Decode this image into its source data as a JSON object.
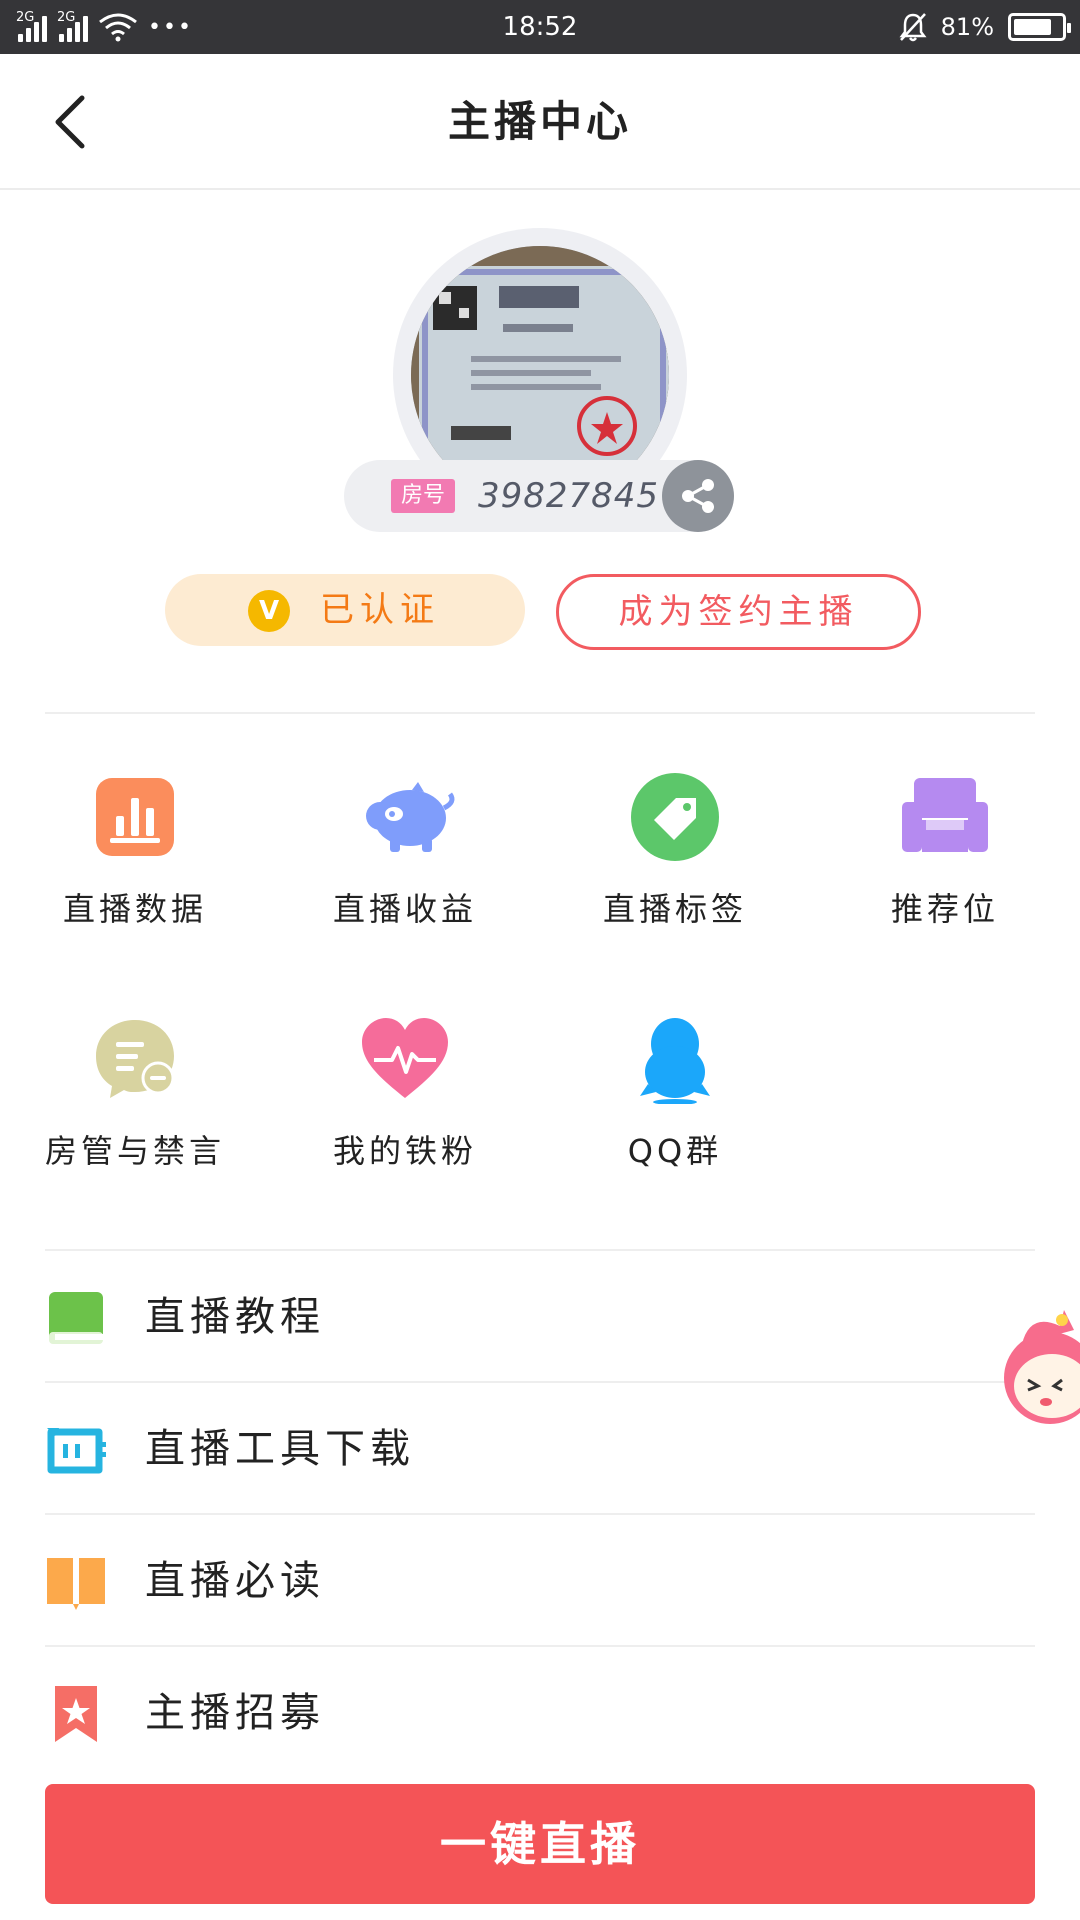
{
  "status_bar": {
    "network1": "2G",
    "network2": "2G",
    "more": "•••",
    "time": "18:52",
    "battery": "81%",
    "battery_level": 0.81
  },
  "header": {
    "title": "主播中心"
  },
  "profile": {
    "room_badge": "房号",
    "room_number": "39827845",
    "verified_label": "已认证",
    "verified_icon_letter": "V",
    "sign_label": "成为签约主播"
  },
  "grid": [
    {
      "label": "直播数据",
      "icon": "bar-chart-icon",
      "color": "#fb8d5c"
    },
    {
      "label": "直播收益",
      "icon": "piggy-bank-icon",
      "color": "#7f9dfb"
    },
    {
      "label": "直播标签",
      "icon": "tag-icon",
      "color": "#5cc76a"
    },
    {
      "label": "推荐位",
      "icon": "sofa-icon",
      "color": "#b58af0"
    },
    {
      "label": "房管与禁言",
      "icon": "chat-mute-icon",
      "color": "#d8d3a0"
    },
    {
      "label": "我的铁粉",
      "icon": "heart-pulse-icon",
      "color": "#f56c9a"
    },
    {
      "label": "QQ群",
      "icon": "qq-penguin-icon",
      "color": "#1ba7fa"
    }
  ],
  "list": [
    {
      "label": "直播教程",
      "icon": "book-icon",
      "color": "#6cc24a"
    },
    {
      "label": "直播工具下载",
      "icon": "tool-download-icon",
      "color": "#26b4e0"
    },
    {
      "label": "直播必读",
      "icon": "open-book-icon",
      "color": "#fca94b"
    },
    {
      "label": "主播招募",
      "icon": "bookmark-star-icon",
      "color": "#f56e66"
    }
  ],
  "live_button": "一键直播",
  "accent": "#f45457"
}
